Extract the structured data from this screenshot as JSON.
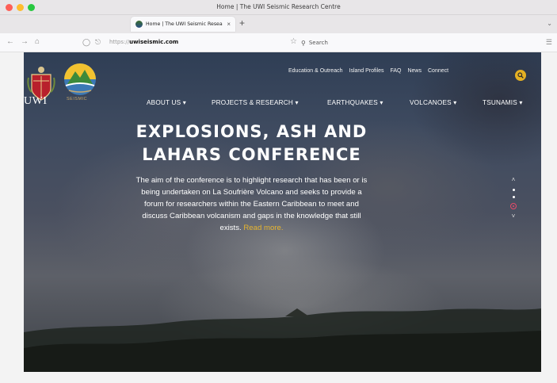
{
  "window": {
    "title": "Home | The UWI Seismic Research Centre"
  },
  "tab": {
    "label": "Home | The UWI Seismic Resea",
    "close": "×",
    "new": "+"
  },
  "browser": {
    "url_prefix": "https://",
    "url_domain": "uwiseismic.com",
    "search_placeholder": "Search",
    "icons": [
      "back-icon",
      "forward-icon",
      "home-icon",
      "shield-icon",
      "lock-icon",
      "star-icon",
      "search-icon",
      "menu-icon"
    ]
  },
  "site": {
    "logo_uwi": "UWI",
    "logo_seismic": "SEISMIC",
    "top_links": [
      "Education & Outreach",
      "Island Profiles",
      "FAQ",
      "News",
      "Connect"
    ],
    "main_nav": [
      "ABOUT US",
      "PROJECTS & RESEARCH",
      "EARTHQUAKES",
      "VOLCANOES",
      "TSUNAMIS"
    ],
    "hero": {
      "title_line1": "EXPLOSIONS, ASH AND",
      "title_line2": "LAHARS CONFERENCE",
      "body": "The aim of the conference is to highlight research that has been or is being undertaken on La Soufrière Volcano and seeks to provide a forum for researchers within the Eastern Caribbean to meet and discuss Caribbean volcanism and gaps in the knowledge that still exists.",
      "read_more": "Read more."
    },
    "slider": {
      "active": 3,
      "total": 3
    }
  },
  "colors": {
    "accent": "#e5b123",
    "link": "#e7b52e",
    "slider_active": "#e84a6a"
  }
}
